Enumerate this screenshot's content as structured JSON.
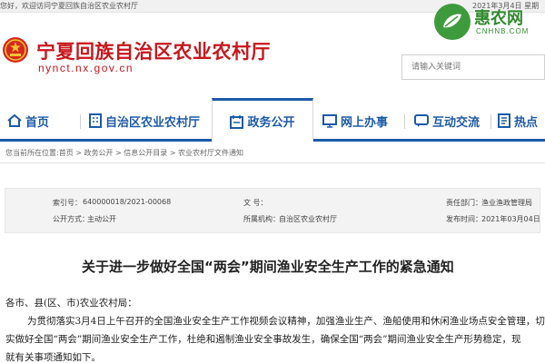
{
  "topbar": {
    "welcome": "您好，欢迎访问宁夏回族自治区农业农村厅",
    "date": "2021年3月4日 星期"
  },
  "header": {
    "site_title": "宁夏回族自治区农业农村厅",
    "domain": "nynct.nx.gov.cn",
    "search_placeholder": "请输入关键词"
  },
  "watermark": {
    "brand": "惠农网",
    "sub": "CNHNB.COM"
  },
  "nav": {
    "items": [
      {
        "label": "首页",
        "icon": "home-icon"
      },
      {
        "label": "自治区农业农村厅",
        "icon": "building-icon"
      },
      {
        "label": "政务公开",
        "icon": "calendar-icon",
        "active": true
      },
      {
        "label": "网上办事",
        "icon": "monitor-icon"
      },
      {
        "label": "互动交流",
        "icon": "chat-icon"
      },
      {
        "label": "热点",
        "icon": "document-icon"
      }
    ]
  },
  "breadcrumb": "您当前所在位置:首页 > 政务公开 > 信息公开目录 > 农业农村厅文件通知",
  "meta": {
    "index_label": "索引号：",
    "index_value": "640000018/2021-00068",
    "doc_no_label": "文  号：",
    "doc_no_value": "",
    "dept_label": "责任部门：",
    "dept_value": "渔业渔政管理局",
    "method_label": "公开方式：",
    "method_value": "主动公开",
    "agency_label": "所属机构：",
    "agency_value": "自治区农业农村厅",
    "date_label": "发布时间：",
    "date_value": "2021年03月04日"
  },
  "article": {
    "title": "关于进一步做好全国“两会”期间渔业安全生产工作的紧急通知",
    "salutation": "各市、县(区、市)农业农村局：",
    "line1": "为贯彻落实3月4日上午召开的全国渔业安全生产工作视频会议精神，加强渔业生产、渔船使用和休闲渔业场点安全管理，切",
    "line2": "实做好全国“两会”期间渔业安全生产工作，杜绝和遏制渔业安全事故发生，确保全国“两会”期间渔业安全生产形势稳定，现",
    "line3": "就有关事项通知如下。"
  }
}
